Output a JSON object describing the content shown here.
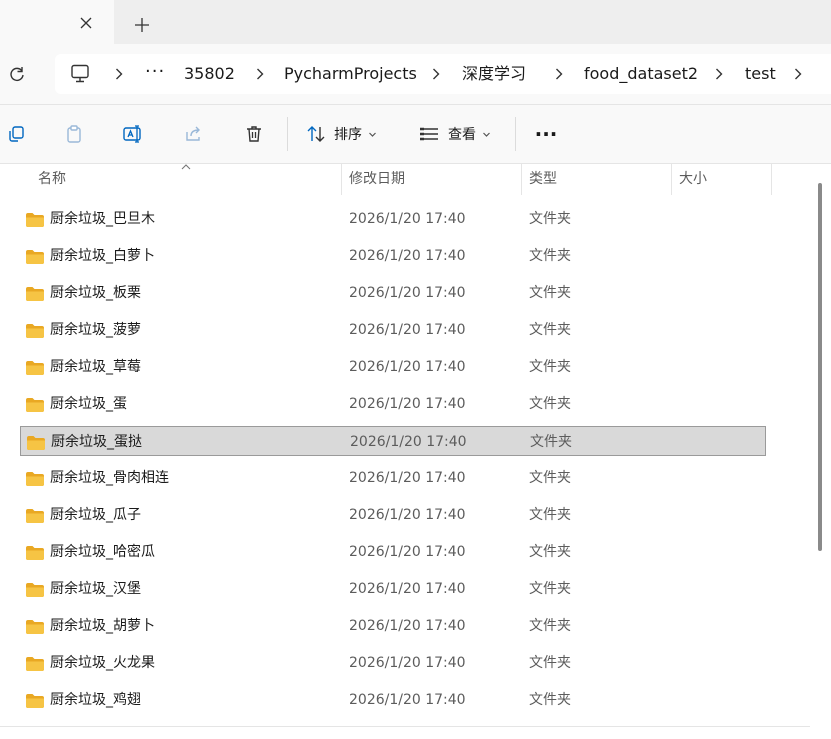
{
  "tabs": {
    "close_icon": "close-icon",
    "add_icon": "plus-icon"
  },
  "address": {
    "more": "···",
    "segments": [
      "35802",
      "PycharmProjects",
      "深度学习",
      "food_dataset2",
      "test"
    ]
  },
  "toolbar": {
    "copy": "copy-icon",
    "paste": "paste-icon",
    "rename": "rename-icon",
    "share": "share-icon",
    "delete": "delete-icon",
    "sort_label": "排序",
    "view_label": "查看",
    "more_label": "···"
  },
  "columns": {
    "name": "名称",
    "modified": "修改日期",
    "type": "类型",
    "size": "大小"
  },
  "files": [
    {
      "name": "厨余垃圾_巴旦木",
      "date": "2026/1/20 17:40",
      "type": "文件夹",
      "selected": false
    },
    {
      "name": "厨余垃圾_白萝卜",
      "date": "2026/1/20 17:40",
      "type": "文件夹",
      "selected": false
    },
    {
      "name": "厨余垃圾_板栗",
      "date": "2026/1/20 17:40",
      "type": "文件夹",
      "selected": false
    },
    {
      "name": "厨余垃圾_菠萝",
      "date": "2026/1/20 17:40",
      "type": "文件夹",
      "selected": false
    },
    {
      "name": "厨余垃圾_草莓",
      "date": "2026/1/20 17:40",
      "type": "文件夹",
      "selected": false
    },
    {
      "name": "厨余垃圾_蛋",
      "date": "2026/1/20 17:40",
      "type": "文件夹",
      "selected": false
    },
    {
      "name": "厨余垃圾_蛋挞",
      "date": "2026/1/20 17:40",
      "type": "文件夹",
      "selected": true
    },
    {
      "name": "厨余垃圾_骨肉相连",
      "date": "2026/1/20 17:40",
      "type": "文件夹",
      "selected": false
    },
    {
      "name": "厨余垃圾_瓜子",
      "date": "2026/1/20 17:40",
      "type": "文件夹",
      "selected": false
    },
    {
      "name": "厨余垃圾_哈密瓜",
      "date": "2026/1/20 17:40",
      "type": "文件夹",
      "selected": false
    },
    {
      "name": "厨余垃圾_汉堡",
      "date": "2026/1/20 17:40",
      "type": "文件夹",
      "selected": false
    },
    {
      "name": "厨余垃圾_胡萝卜",
      "date": "2026/1/20 17:40",
      "type": "文件夹",
      "selected": false
    },
    {
      "name": "厨余垃圾_火龙果",
      "date": "2026/1/20 17:40",
      "type": "文件夹",
      "selected": false
    },
    {
      "name": "厨余垃圾_鸡翅",
      "date": "2026/1/20 17:40",
      "type": "文件夹",
      "selected": false
    }
  ],
  "colors": {
    "folder": "#f6c444",
    "folder_dark": "#e9a823",
    "accent": "#0067c0",
    "selection": "#d9d9d9"
  }
}
